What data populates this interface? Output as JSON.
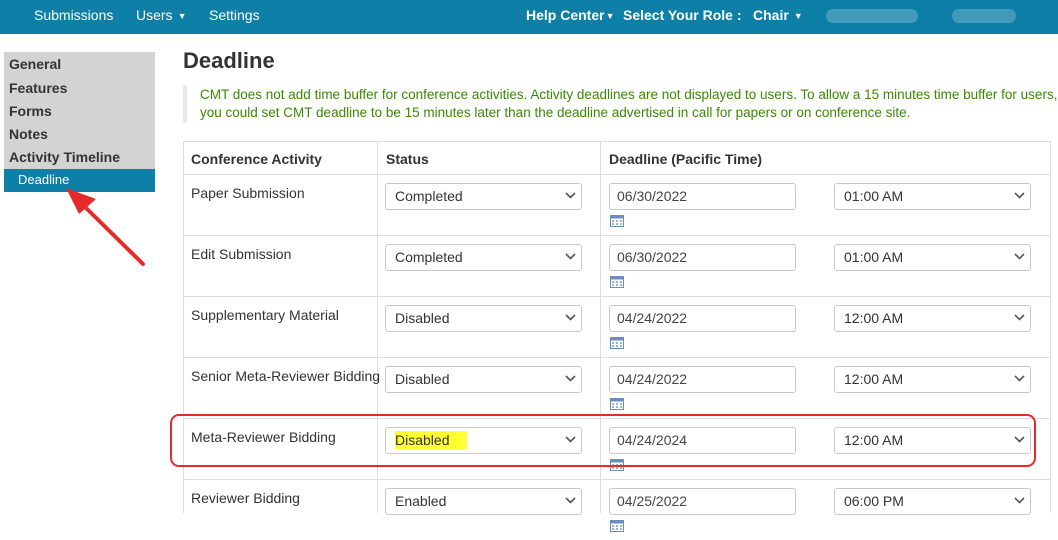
{
  "topbar": {
    "submissions": "Submissions",
    "users": "Users",
    "settings": "Settings",
    "help_center": "Help Center",
    "select_role": "Select Your Role :",
    "role": "Chair"
  },
  "sidebar": {
    "items": [
      "General",
      "Features",
      "Forms",
      "Notes",
      "Activity Timeline"
    ],
    "active": "Deadline"
  },
  "page": {
    "title": "Deadline",
    "notice_line1": "CMT does not add time buffer for conference activities. Activity deadlines are not displayed to users. To allow a 15 minutes time buffer for users,",
    "notice_line2": "you could set CMT deadline to be 15 minutes later than the deadline advertised in call for papers or on conference site."
  },
  "table": {
    "headers": [
      "Conference Activity",
      "Status",
      "Deadline (Pacific Time)"
    ],
    "rows": [
      {
        "activity": "Paper Submission",
        "status": "Completed",
        "date": "06/30/2022",
        "time": "01:00 AM"
      },
      {
        "activity": "Edit Submission",
        "status": "Completed",
        "date": "06/30/2022",
        "time": "01:00 AM"
      },
      {
        "activity": "Supplementary Material",
        "status": "Disabled",
        "date": "04/24/2022",
        "time": "12:00 AM"
      },
      {
        "activity": "Senior Meta-Reviewer Bidding",
        "status": "Disabled",
        "date": "04/24/2022",
        "time": "12:00 AM"
      },
      {
        "activity": "Meta-Reviewer Bidding",
        "status": "Disabled",
        "date": "04/24/2024",
        "time": "12:00 AM"
      },
      {
        "activity": "Reviewer Bidding",
        "status": "Enabled",
        "date": "04/25/2022",
        "time": "06:00 PM"
      }
    ]
  },
  "colors": {
    "brand": "#0e7fa6",
    "notice_text": "#3a8a00",
    "annotation": "#e52a2a",
    "highlight": "#ffff33"
  }
}
